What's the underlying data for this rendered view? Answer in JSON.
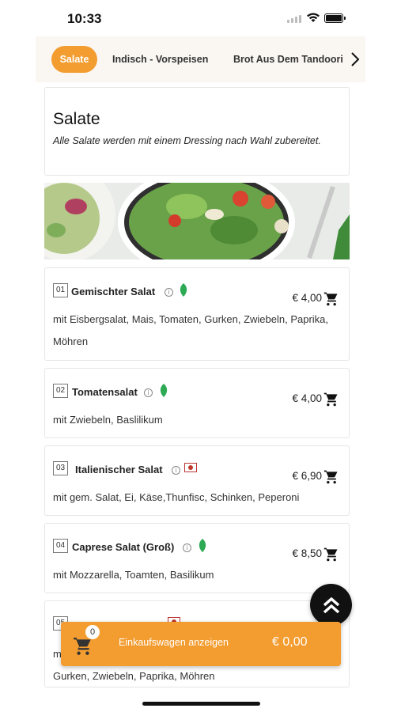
{
  "status": {
    "time": "10:33"
  },
  "tabs": [
    {
      "label": "Salate",
      "active": true
    },
    {
      "label": "Indisch - Vorspeisen",
      "active": false
    },
    {
      "label": "Brot Aus Dem Tandoori Ofen",
      "active": false
    }
  ],
  "category": {
    "title": "Salate",
    "description": "Alle Salate werden mit einem Dressing nach Wahl zubereitet."
  },
  "items": [
    {
      "num": "01",
      "name": "Gemischter Salat",
      "price": "€ 4,00",
      "desc": "mit Eisbergsalat, Mais, Tomaten, Gurken, Zwiebeln, Paprika, Möhren",
      "tag": "vegan-leaf-icon"
    },
    {
      "num": "02",
      "name": "Tomatensalat",
      "price": "€ 4,00",
      "desc": "mit Zwiebeln, Baslilikum",
      "tag": "vegan-leaf-icon"
    },
    {
      "num": "03",
      "name": "Italienischer Salat",
      "price": "€ 6,90",
      "desc": "mit gem. Salat, Ei, Käse,Thunfisc, Schinken, Peperoni",
      "tag": "meat-icon"
    },
    {
      "num": "04",
      "name": "Caprese Salat (Groß)",
      "price": "€ 8,50",
      "desc": "mit Mozzarella, Toamten, Basilikum",
      "tag": "vegan-leaf-icon"
    },
    {
      "num": "05",
      "name": "",
      "price": "",
      "desc_partial_1": "m",
      "desc_partial_2": "Gurken, Zwiebeln, Paprika, Möhren",
      "tag": "meat-icon"
    }
  ],
  "cart": {
    "count": "0",
    "label": "Einkaufswagen anzeigen",
    "total": "€ 0,00"
  },
  "colors": {
    "accent": "#f39c2f",
    "leaf": "#2eaa55"
  }
}
